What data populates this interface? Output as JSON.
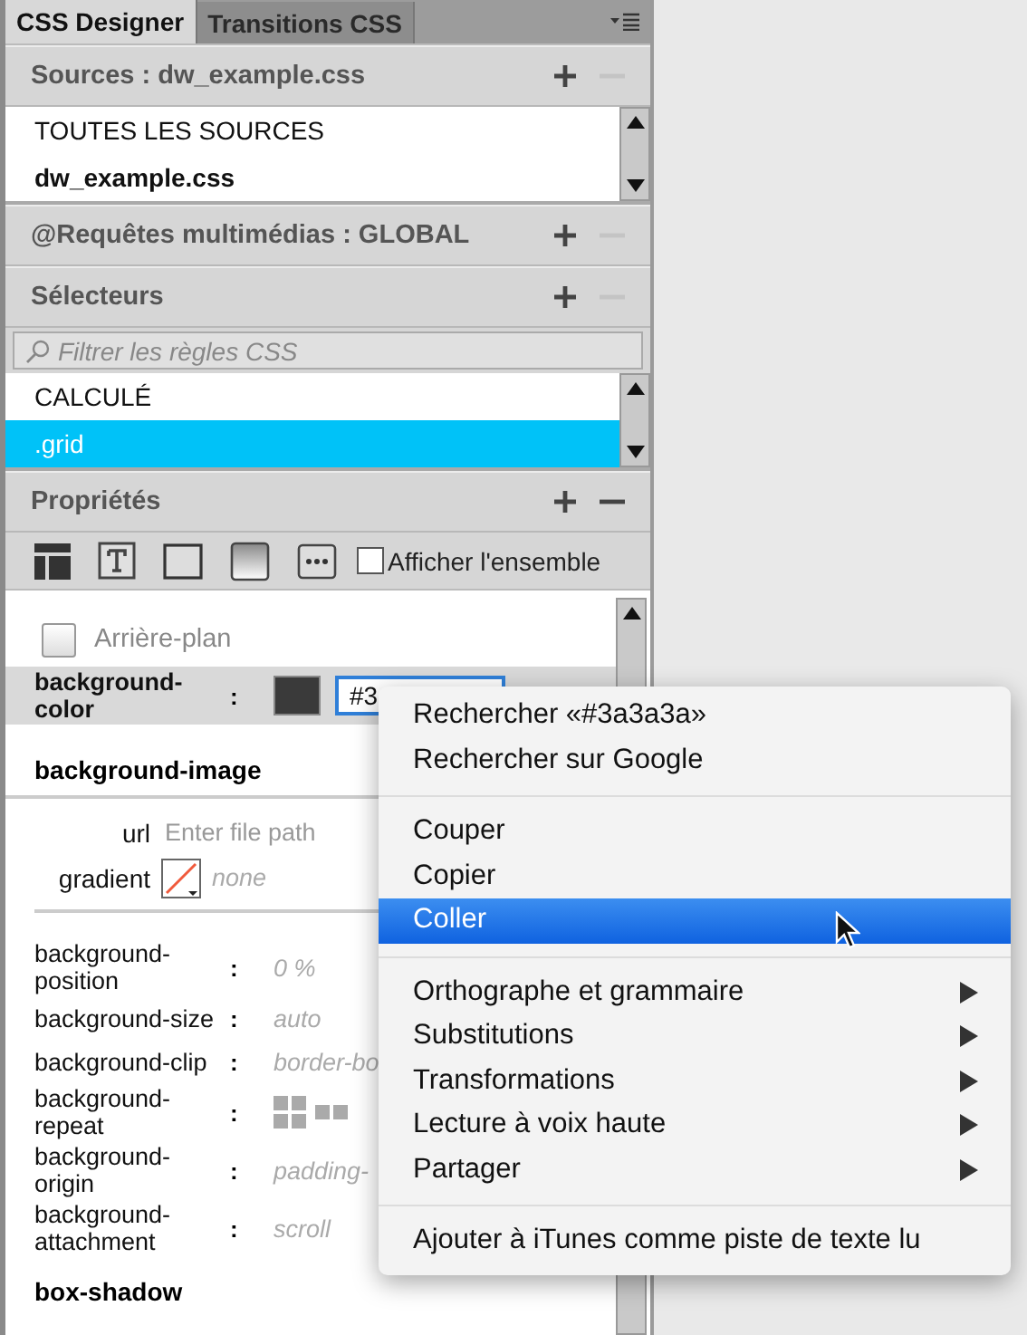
{
  "tabs": [
    {
      "label": "CSS Designer",
      "selected": true
    },
    {
      "label": "Transitions CSS",
      "selected": false
    }
  ],
  "sources": {
    "title": "Sources :  dw_example.css",
    "remove_disabled": true,
    "items": [
      {
        "label": "TOUTES LES SOURCES",
        "bold": false
      },
      {
        "label": "dw_example.css",
        "bold": true
      }
    ]
  },
  "media": {
    "title": "@Requêtes multimédias : GLOBAL",
    "remove_disabled": true
  },
  "selectors": {
    "title": "Sélecteurs",
    "remove_disabled": true,
    "filter_placeholder": "Filtrer les règles CSS",
    "items": [
      {
        "label": "CALCULÉ",
        "selected": false
      },
      {
        "label": ".grid",
        "selected": true
      }
    ]
  },
  "properties": {
    "title": "Propriétés",
    "remove_disabled": false,
    "show_all": {
      "label": "Afficher l'ensemble",
      "checked": false
    },
    "category": {
      "label": "Arrière-plan",
      "checked": false
    },
    "background_color": {
      "name": "background-color",
      "colon": ":",
      "value": "#3",
      "color": "#3a3a3a"
    },
    "background_image": {
      "title": "background-image",
      "url_label": "url",
      "url_placeholder": "Enter file path",
      "gradient_label": "gradient",
      "gradient_value": "none"
    },
    "rows": [
      {
        "name": "background-position",
        "colon": ":",
        "kind": "text",
        "value": "0 %"
      },
      {
        "name": "background-size",
        "colon": ":",
        "kind": "text",
        "value": "auto"
      },
      {
        "name": "background-clip",
        "colon": ":",
        "kind": "text",
        "value": "border-bo"
      },
      {
        "name": "background-repeat",
        "colon": ":",
        "kind": "repeat"
      },
      {
        "name": "background-origin",
        "colon": ":",
        "kind": "text",
        "value": "padding-"
      },
      {
        "name": "background-attachment",
        "colon": ":",
        "kind": "text",
        "value": "scroll"
      }
    ],
    "box_shadow": "box-shadow"
  },
  "context_menu": {
    "groups": [
      [
        {
          "label": "Rechercher «#3a3a3a»",
          "selected": false,
          "submenu": false
        },
        {
          "label": "Rechercher sur Google",
          "selected": false,
          "submenu": false
        }
      ],
      [
        {
          "label": "Couper",
          "selected": false,
          "submenu": false
        },
        {
          "label": "Copier",
          "selected": false,
          "submenu": false
        },
        {
          "label": "Coller",
          "selected": true,
          "submenu": false
        }
      ],
      [
        {
          "label": "Orthographe et grammaire",
          "selected": false,
          "submenu": true
        },
        {
          "label": "Substitutions",
          "selected": false,
          "submenu": true
        },
        {
          "label": "Transformations",
          "selected": false,
          "submenu": true
        },
        {
          "label": "Lecture à voix haute",
          "selected": false,
          "submenu": true
        },
        {
          "label": "Partager",
          "selected": false,
          "submenu": true
        }
      ],
      [
        {
          "label": "Ajouter à iTunes comme piste de texte lu",
          "selected": false,
          "submenu": false
        }
      ]
    ]
  }
}
